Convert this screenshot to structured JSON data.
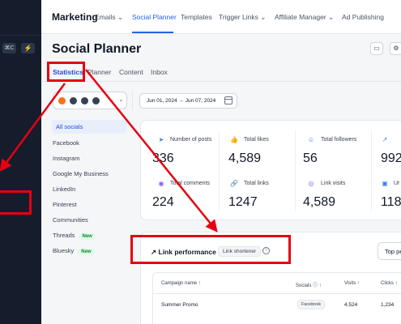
{
  "sidebar": {
    "shortcut_key": "⌘C",
    "bolt_icon": "bolt-icon"
  },
  "topnav": {
    "title": "Marketing",
    "items": [
      "Emails",
      "Social Planner",
      "Templates",
      "Trigger Links",
      "Affiliate Manager",
      "Ad Publishing"
    ],
    "active_item": "Social Planner"
  },
  "page": {
    "title": "Social Planner",
    "header_icons": [
      "chat-icon",
      "gear-icon"
    ]
  },
  "tabs": [
    "Statistics",
    "Planner",
    "Content",
    "Inbox"
  ],
  "active_tab": "Statistics",
  "filters": {
    "date_range": "Jun 01, 2024 → Jun 07, 2024"
  },
  "socials": [
    {
      "label": "All socials",
      "active": true
    },
    {
      "label": "Facebook"
    },
    {
      "label": "Instagram"
    },
    {
      "label": "Google My Business"
    },
    {
      "label": "LinkedIn"
    },
    {
      "label": "Pinterest"
    },
    {
      "label": "Communities"
    },
    {
      "label": "Threads",
      "badge": "New"
    },
    {
      "label": "Bluesky",
      "badge": "New"
    }
  ],
  "stats": [
    {
      "label": "Number of posts",
      "value": "336",
      "icon": "send-icon"
    },
    {
      "label": "Total likes",
      "value": "4,589",
      "icon": "thumbs-up-icon"
    },
    {
      "label": "Total followers",
      "value": "56",
      "icon": "users-icon"
    },
    {
      "label": "",
      "value": "992",
      "icon": "share-icon"
    },
    {
      "label": "Total comments",
      "value": "224",
      "icon": "comment-icon"
    },
    {
      "label": "Total links",
      "value": "1247",
      "icon": "link-icon"
    },
    {
      "label": "Link visits",
      "value": "4,589",
      "icon": "eye-icon"
    },
    {
      "label": "Ur",
      "value": "118",
      "icon": "user-icon"
    }
  ],
  "link_performance": {
    "title": "Link performance",
    "badge": "Link shortener",
    "top_select": "Top pe",
    "columns": [
      "Campaign name ↑",
      "Socials ⓘ ↑",
      "Visits ↑",
      "Clicks ↑"
    ],
    "rows": [
      {
        "campaign": "Summer Promo",
        "social": "Facebook",
        "visits": "4,524",
        "clicks": "1,234"
      }
    ]
  }
}
